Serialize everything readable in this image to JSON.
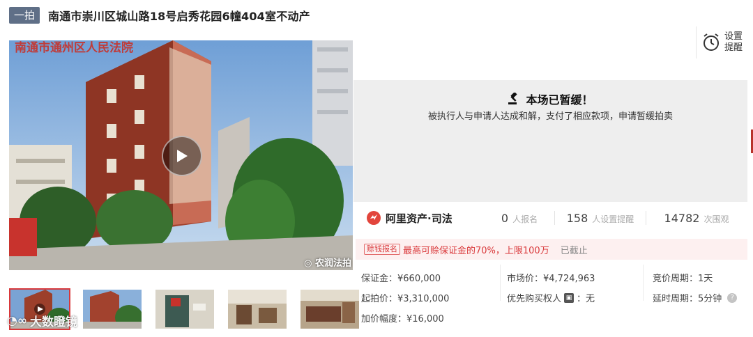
{
  "header": {
    "badge": "一拍",
    "title": "南通市崇川区城山路18号启秀花园6幢404室不动产"
  },
  "reminder": {
    "label": "设置提醒"
  },
  "gallery": {
    "overlay_text": "南通市通州区人民法院",
    "watermark": "农润法拍",
    "thumbnail_count": 5
  },
  "page_watermark": "大数瞪镜",
  "status": {
    "title": "本场已暂缓！",
    "description": "被执行人与申请人达成和解，支付了相应款项，申请暂缓拍卖"
  },
  "brand": {
    "name": "阿里资产·司法"
  },
  "stats": [
    {
      "value": "0",
      "label": "人报名"
    },
    {
      "value": "158",
      "label": "人设置提醒"
    },
    {
      "value": "14782",
      "label": "次围观"
    }
  ],
  "notice": {
    "tag": "赊钱报名",
    "text": "最高可赊保证金的70%，上限100万",
    "status": "已截止"
  },
  "info": {
    "deposit": "保证金：¥660,000",
    "market_price": "市场价：¥4,724,963",
    "bid_period": "竞价周期：1天",
    "start_price": "起拍价：¥3,310,000",
    "priority_prefix": "优先购买权人",
    "priority_suffix": "：无",
    "extension_period": "延时周期：5分钟",
    "increment": "加价幅度：¥16,000"
  },
  "colors": {
    "badge": "#5f6f87",
    "accent_red": "#d9383a",
    "status_bg": "#eeeeee",
    "notice_bg": "#fdf0f0"
  },
  "icons": [
    "play-icon",
    "alarm-clock-icon",
    "gavel-icon",
    "ali-brand-logo",
    "help-icon"
  ]
}
